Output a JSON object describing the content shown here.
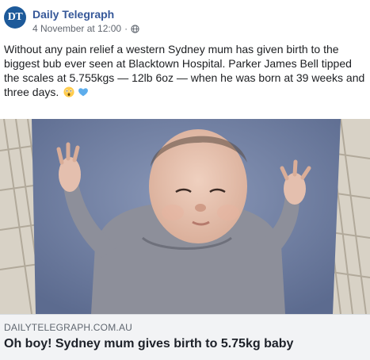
{
  "post": {
    "page_name": "Daily Telegraph",
    "avatar_text": "DT",
    "timestamp": "4 November at 12:00",
    "separator": "·",
    "privacy_icon": "globe-icon",
    "text": "Without any pain relief a western Sydney mum has given birth to the biggest bub ever seen at Blacktown Hospital. Parker James Bell tipped the scales at 5.755kgs — 12lb 6oz — when he was born at 39 weeks and three days.",
    "emojis": [
      "astonished-face-icon",
      "blue-heart-icon"
    ]
  },
  "link": {
    "domain": "DAILYTELEGRAPH.COM.AU",
    "headline": "Oh boy! Sydney mum gives birth to 5.75kg baby"
  },
  "colors": {
    "page_name": "#365899",
    "avatar_bg": "#1d5a9a",
    "link_box_bg": "#f2f3f5"
  }
}
